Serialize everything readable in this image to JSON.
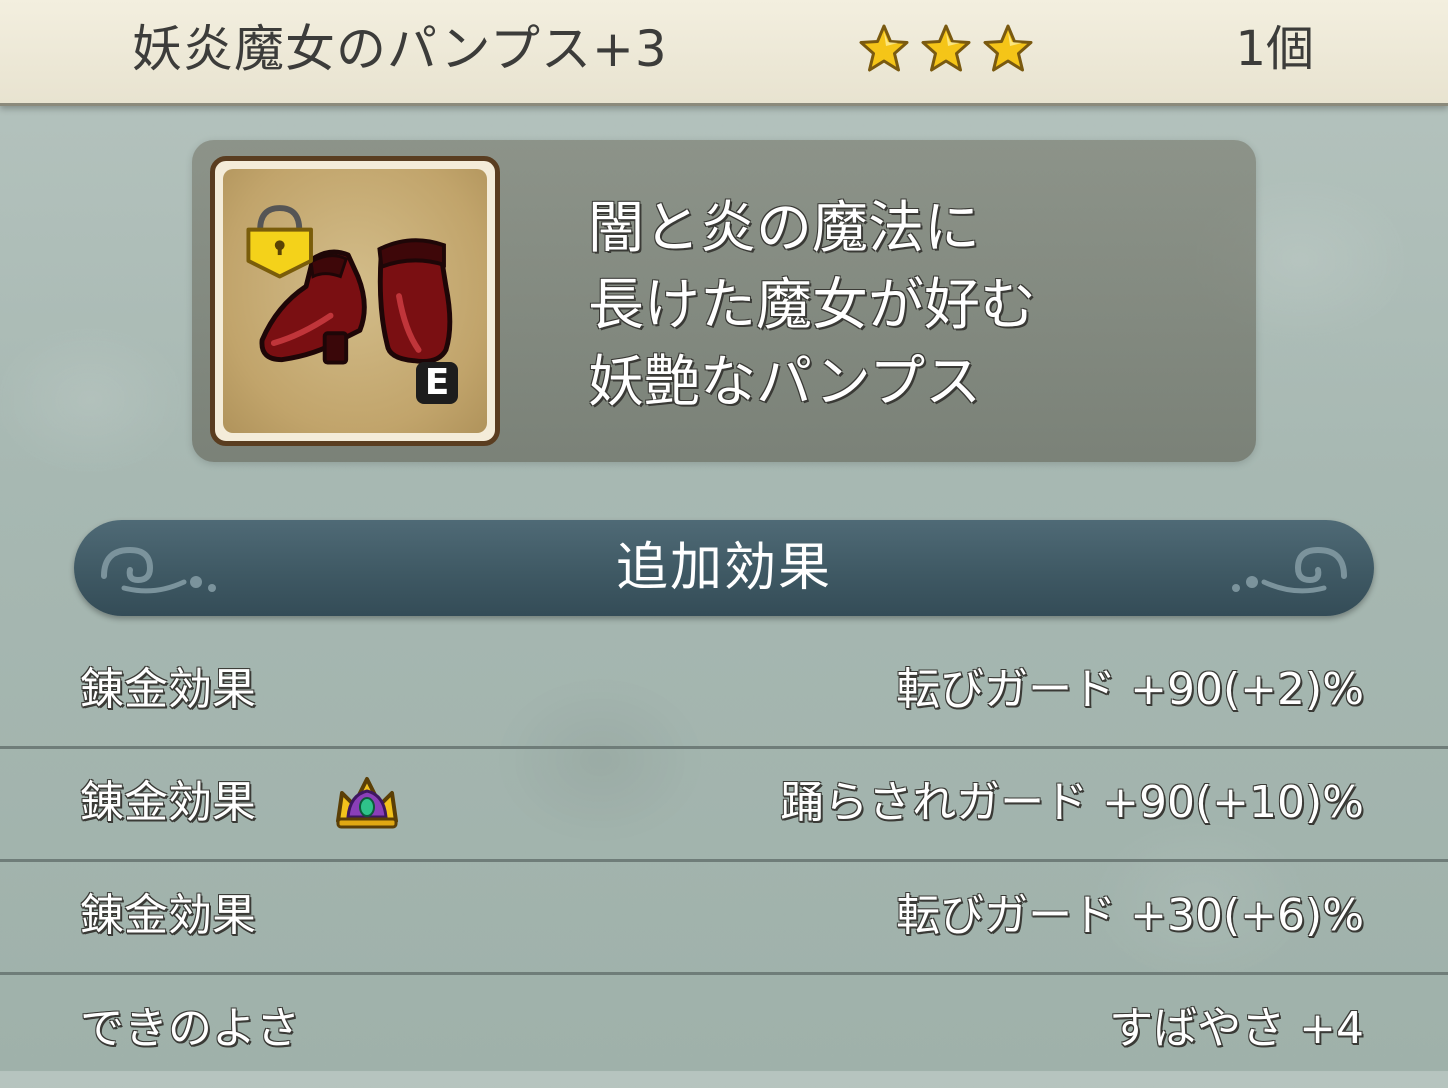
{
  "header": {
    "item_name": "妖炎魔女のパンプス+3",
    "rating_stars": 3,
    "quantity": "1個"
  },
  "item": {
    "icon": "red-pumps-icon",
    "lock_icon": "lock-icon",
    "equipped_badge": "E",
    "description_lines": [
      "闇と炎の魔法に",
      "長けた魔女が好む",
      "妖艶なパンプス"
    ]
  },
  "section": {
    "title": "追加効果"
  },
  "effects": [
    {
      "label": "錬金効果",
      "value": "転びガード +90(+2)%",
      "icon": null
    },
    {
      "label": "錬金効果",
      "value": "踊らされガード +90(+10)%",
      "icon": "crown-icon"
    },
    {
      "label": "錬金効果",
      "value": "転びガード +30(+6)%",
      "icon": null
    },
    {
      "label": "できのよさ",
      "value": "すばやさ +4",
      "icon": null
    }
  ],
  "colors": {
    "header_bg": "#f3efdf",
    "star": "#f5c518",
    "banner": "#3f5964",
    "panel": "#6e6e60"
  }
}
